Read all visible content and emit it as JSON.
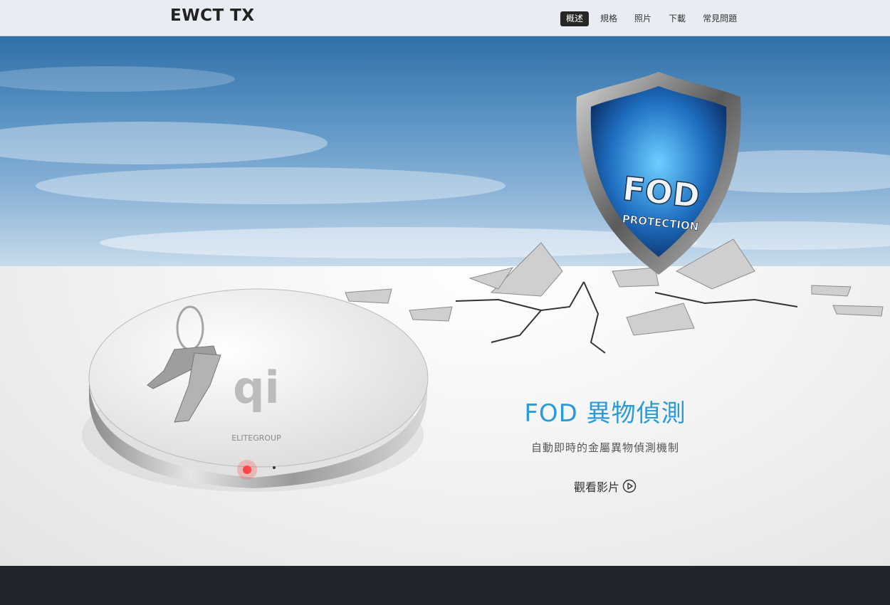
{
  "header": {
    "brand": "EWCT TX",
    "nav": [
      {
        "label": "概述",
        "active": true
      },
      {
        "label": "規格",
        "active": false
      },
      {
        "label": "照片",
        "active": false
      },
      {
        "label": "下載",
        "active": false
      },
      {
        "label": "常見問題",
        "active": false
      }
    ]
  },
  "hero": {
    "shield": {
      "line1": "FOD",
      "line2": "PROTECTION"
    },
    "charger": {
      "logo": "qi",
      "brand": "ELITEGROUP"
    },
    "title": "FOD 異物偵測",
    "subtitle": "自動即時的金屬異物偵測機制",
    "watch_label": "觀看影片",
    "watch_icon": "play-circle-icon"
  },
  "colors": {
    "accent": "#2a9bd6",
    "navbar_bg": "#e9edf3",
    "footer_bg": "#22252b",
    "active_tab_bg": "#262626"
  }
}
